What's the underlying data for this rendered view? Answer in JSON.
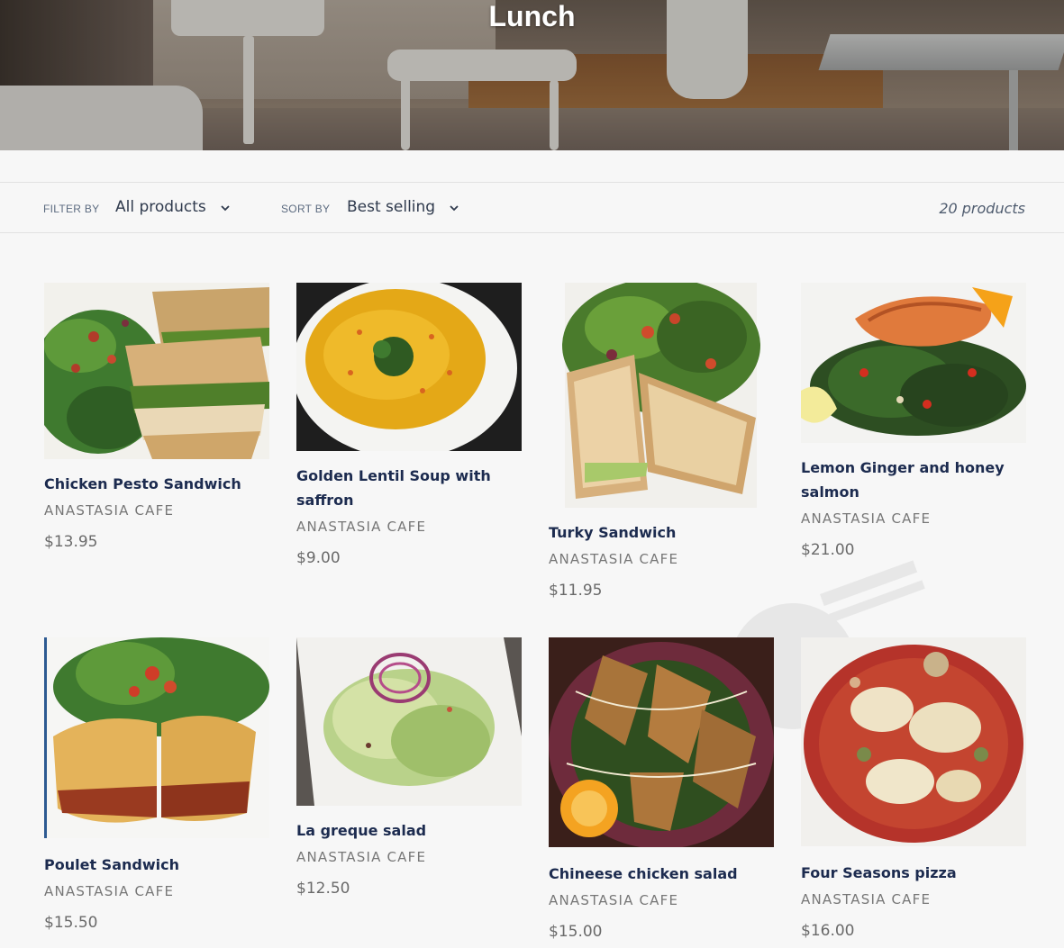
{
  "hero": {
    "title": "Lunch"
  },
  "filter_bar": {
    "filter_label": "Filter by",
    "filter_value": "All products",
    "sort_label": "Sort by",
    "sort_value": "Best selling",
    "count": "20 products"
  },
  "products": [
    {
      "title_lines": [
        "Chicken Pesto Sandwich"
      ],
      "vendor": "ANASTASIA CAFE",
      "price": "$13.95"
    },
    {
      "title_lines": [
        "Golden Lentil Soup with",
        "saffron"
      ],
      "vendor": "ANASTASIA CAFE",
      "price": "$9.00"
    },
    {
      "title_lines": [
        "Turky Sandwich"
      ],
      "vendor": "ANASTASIA CAFE",
      "price": "$11.95"
    },
    {
      "title_lines": [
        "Lemon Ginger and honey",
        "salmon"
      ],
      "vendor": "ANASTASIA CAFE",
      "price": "$21.00"
    },
    {
      "title_lines": [
        "Poulet Sandwich"
      ],
      "vendor": "ANASTASIA CAFE",
      "price": "$15.50"
    },
    {
      "title_lines": [
        "La greque salad"
      ],
      "vendor": "ANASTASIA CAFE",
      "price": "$12.50"
    },
    {
      "title_lines": [
        "Chineese chicken salad"
      ],
      "vendor": "ANASTASIA CAFE",
      "price": "$15.00"
    },
    {
      "title_lines": [
        "Four Seasons pizza"
      ],
      "vendor": "ANASTASIA CAFE",
      "price": "$16.00"
    }
  ],
  "icons": {
    "dropdown": "chevron-down-icon",
    "watermark": "fork-icon"
  }
}
